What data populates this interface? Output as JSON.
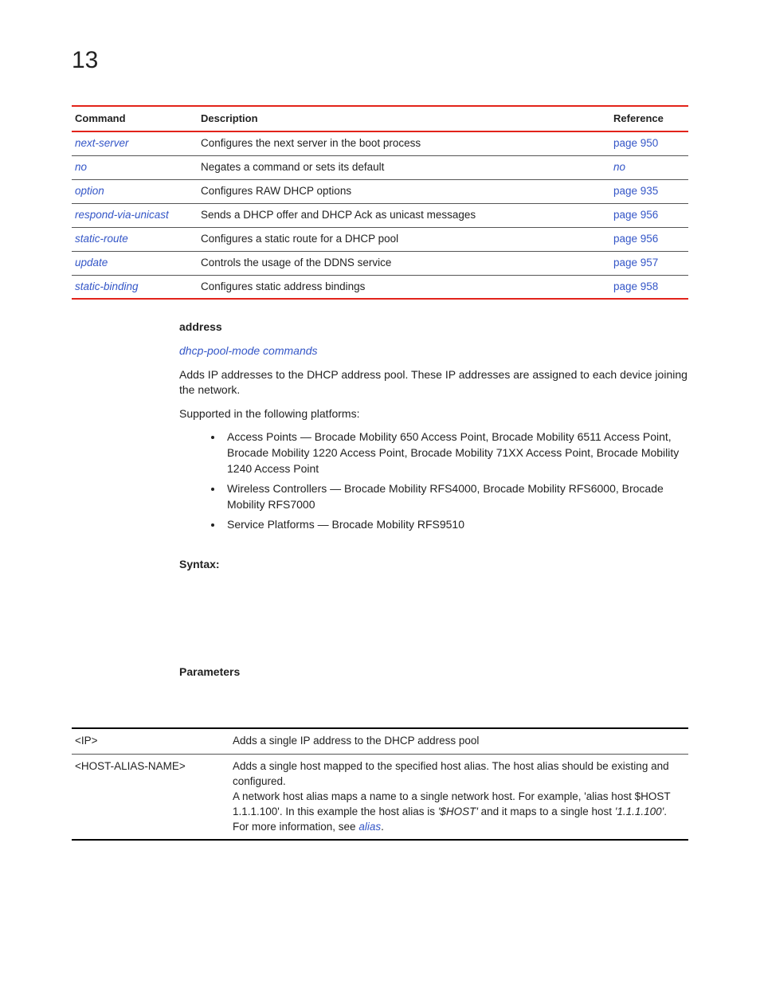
{
  "chapter": "13",
  "cmd_table": {
    "headers": {
      "command": "Command",
      "description": "Description",
      "reference": "Reference"
    },
    "rows": [
      {
        "cmd": "next-server",
        "desc": "Configures the next server in the boot process",
        "ref": "page 950"
      },
      {
        "cmd": "no",
        "desc": "Negates a command or sets its default",
        "ref": "no"
      },
      {
        "cmd": "option",
        "desc": "Configures RAW DHCP options",
        "ref": "page 935"
      },
      {
        "cmd": "respond-via-unicast",
        "desc": "Sends a DHCP offer and DHCP Ack as unicast messages",
        "ref": "page 956"
      },
      {
        "cmd": "static-route",
        "desc": "Configures a static route for a DHCP pool",
        "ref": "page 956"
      },
      {
        "cmd": "update",
        "desc": "Controls the usage of the DDNS service",
        "ref": "page 957"
      },
      {
        "cmd": "static-binding",
        "desc": "Configures static address bindings",
        "ref": "page 958"
      }
    ]
  },
  "section": {
    "title": "address",
    "breadcrumb": "dhcp-pool-mode commands",
    "intro": "Adds IP addresses to the DHCP address pool. These IP addresses are assigned to each device joining the network.",
    "supported": "Supported in the following platforms:",
    "bullets": [
      "Access Points — Brocade Mobility 650 Access Point, Brocade Mobility 6511 Access Point, Brocade Mobility 1220 Access Point, Brocade Mobility 71XX Access Point, Brocade Mobility 1240 Access Point",
      "Wireless Controllers — Brocade Mobility RFS4000, Brocade Mobility RFS6000, Brocade Mobility RFS7000",
      "Service Platforms — Brocade Mobility RFS9510"
    ],
    "syntax_label": "Syntax:",
    "params_label": "Parameters"
  },
  "param_table": {
    "rows": [
      {
        "name": "<IP>",
        "desc": "Adds a single IP address to the DHCP address pool"
      },
      {
        "name": "<HOST-ALIAS-NAME>",
        "desc_line1": "Adds a single host mapped to the specified host alias. The host alias should be existing and configured.",
        "desc_line2_a": "A network host alias maps a name to a single network host. For example, 'alias host $HOST 1.1.1.100'. In this example the host alias is ",
        "desc_line2_b": "'$HOST'",
        "desc_line2_c": " and it maps to a single host ",
        "desc_line2_d": "'1.1.1.100'",
        "desc_line2_e": ". For more information, see ",
        "desc_link": "alias",
        "desc_line2_f": "."
      }
    ]
  }
}
